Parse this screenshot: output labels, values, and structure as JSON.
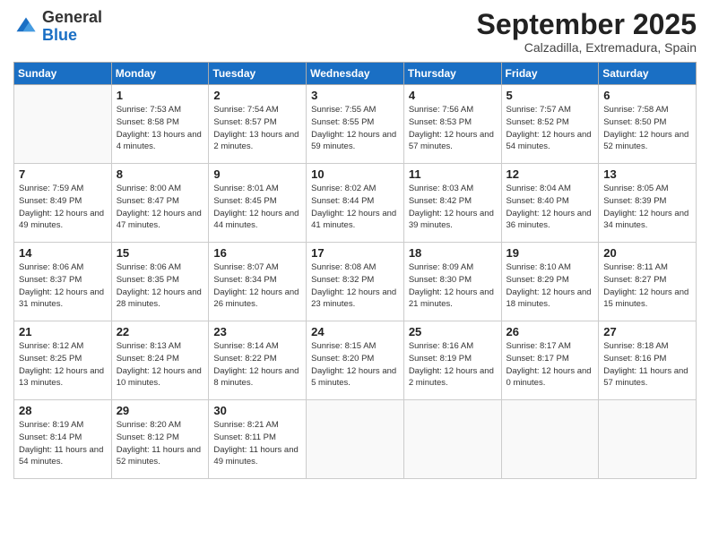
{
  "header": {
    "logo_general": "General",
    "logo_blue": "Blue",
    "month_title": "September 2025",
    "location": "Calzadilla, Extremadura, Spain"
  },
  "weekdays": [
    "Sunday",
    "Monday",
    "Tuesday",
    "Wednesday",
    "Thursday",
    "Friday",
    "Saturday"
  ],
  "weeks": [
    [
      {
        "day": "",
        "detail": ""
      },
      {
        "day": "1",
        "detail": "Sunrise: 7:53 AM\nSunset: 8:58 PM\nDaylight: 13 hours\nand 4 minutes."
      },
      {
        "day": "2",
        "detail": "Sunrise: 7:54 AM\nSunset: 8:57 PM\nDaylight: 13 hours\nand 2 minutes."
      },
      {
        "day": "3",
        "detail": "Sunrise: 7:55 AM\nSunset: 8:55 PM\nDaylight: 12 hours\nand 59 minutes."
      },
      {
        "day": "4",
        "detail": "Sunrise: 7:56 AM\nSunset: 8:53 PM\nDaylight: 12 hours\nand 57 minutes."
      },
      {
        "day": "5",
        "detail": "Sunrise: 7:57 AM\nSunset: 8:52 PM\nDaylight: 12 hours\nand 54 minutes."
      },
      {
        "day": "6",
        "detail": "Sunrise: 7:58 AM\nSunset: 8:50 PM\nDaylight: 12 hours\nand 52 minutes."
      }
    ],
    [
      {
        "day": "7",
        "detail": "Sunrise: 7:59 AM\nSunset: 8:49 PM\nDaylight: 12 hours\nand 49 minutes."
      },
      {
        "day": "8",
        "detail": "Sunrise: 8:00 AM\nSunset: 8:47 PM\nDaylight: 12 hours\nand 47 minutes."
      },
      {
        "day": "9",
        "detail": "Sunrise: 8:01 AM\nSunset: 8:45 PM\nDaylight: 12 hours\nand 44 minutes."
      },
      {
        "day": "10",
        "detail": "Sunrise: 8:02 AM\nSunset: 8:44 PM\nDaylight: 12 hours\nand 41 minutes."
      },
      {
        "day": "11",
        "detail": "Sunrise: 8:03 AM\nSunset: 8:42 PM\nDaylight: 12 hours\nand 39 minutes."
      },
      {
        "day": "12",
        "detail": "Sunrise: 8:04 AM\nSunset: 8:40 PM\nDaylight: 12 hours\nand 36 minutes."
      },
      {
        "day": "13",
        "detail": "Sunrise: 8:05 AM\nSunset: 8:39 PM\nDaylight: 12 hours\nand 34 minutes."
      }
    ],
    [
      {
        "day": "14",
        "detail": "Sunrise: 8:06 AM\nSunset: 8:37 PM\nDaylight: 12 hours\nand 31 minutes."
      },
      {
        "day": "15",
        "detail": "Sunrise: 8:06 AM\nSunset: 8:35 PM\nDaylight: 12 hours\nand 28 minutes."
      },
      {
        "day": "16",
        "detail": "Sunrise: 8:07 AM\nSunset: 8:34 PM\nDaylight: 12 hours\nand 26 minutes."
      },
      {
        "day": "17",
        "detail": "Sunrise: 8:08 AM\nSunset: 8:32 PM\nDaylight: 12 hours\nand 23 minutes."
      },
      {
        "day": "18",
        "detail": "Sunrise: 8:09 AM\nSunset: 8:30 PM\nDaylight: 12 hours\nand 21 minutes."
      },
      {
        "day": "19",
        "detail": "Sunrise: 8:10 AM\nSunset: 8:29 PM\nDaylight: 12 hours\nand 18 minutes."
      },
      {
        "day": "20",
        "detail": "Sunrise: 8:11 AM\nSunset: 8:27 PM\nDaylight: 12 hours\nand 15 minutes."
      }
    ],
    [
      {
        "day": "21",
        "detail": "Sunrise: 8:12 AM\nSunset: 8:25 PM\nDaylight: 12 hours\nand 13 minutes."
      },
      {
        "day": "22",
        "detail": "Sunrise: 8:13 AM\nSunset: 8:24 PM\nDaylight: 12 hours\nand 10 minutes."
      },
      {
        "day": "23",
        "detail": "Sunrise: 8:14 AM\nSunset: 8:22 PM\nDaylight: 12 hours\nand 8 minutes."
      },
      {
        "day": "24",
        "detail": "Sunrise: 8:15 AM\nSunset: 8:20 PM\nDaylight: 12 hours\nand 5 minutes."
      },
      {
        "day": "25",
        "detail": "Sunrise: 8:16 AM\nSunset: 8:19 PM\nDaylight: 12 hours\nand 2 minutes."
      },
      {
        "day": "26",
        "detail": "Sunrise: 8:17 AM\nSunset: 8:17 PM\nDaylight: 12 hours\nand 0 minutes."
      },
      {
        "day": "27",
        "detail": "Sunrise: 8:18 AM\nSunset: 8:16 PM\nDaylight: 11 hours\nand 57 minutes."
      }
    ],
    [
      {
        "day": "28",
        "detail": "Sunrise: 8:19 AM\nSunset: 8:14 PM\nDaylight: 11 hours\nand 54 minutes."
      },
      {
        "day": "29",
        "detail": "Sunrise: 8:20 AM\nSunset: 8:12 PM\nDaylight: 11 hours\nand 52 minutes."
      },
      {
        "day": "30",
        "detail": "Sunrise: 8:21 AM\nSunset: 8:11 PM\nDaylight: 11 hours\nand 49 minutes."
      },
      {
        "day": "",
        "detail": ""
      },
      {
        "day": "",
        "detail": ""
      },
      {
        "day": "",
        "detail": ""
      },
      {
        "day": "",
        "detail": ""
      }
    ]
  ]
}
